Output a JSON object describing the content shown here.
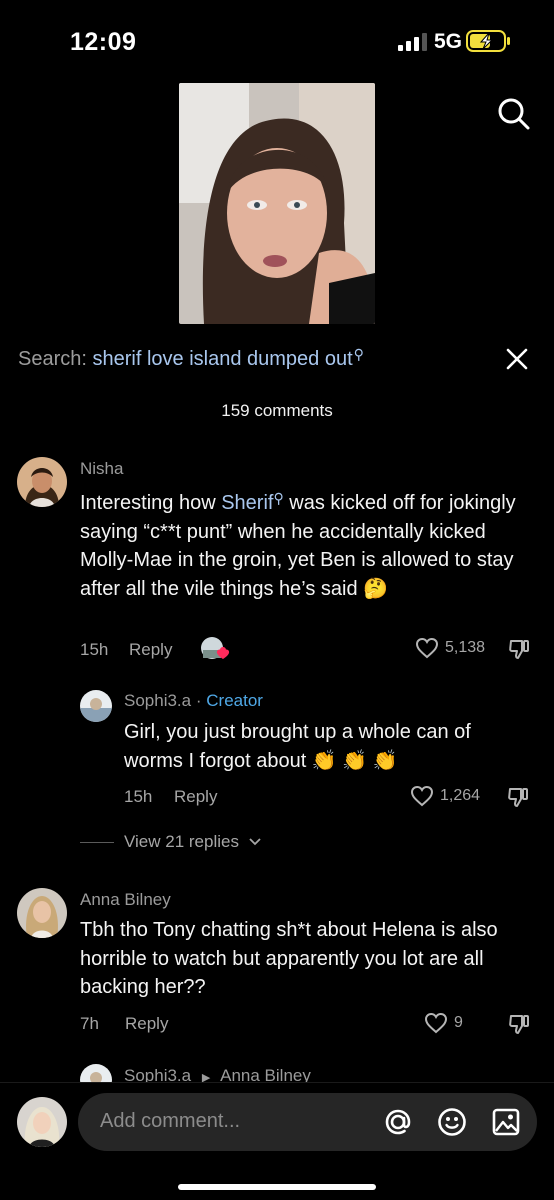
{
  "status_bar": {
    "time": "12:09",
    "network": "5G"
  },
  "search": {
    "prefix": "Search:",
    "query": "sherif love island dumped out",
    "search_icon": "search-icon",
    "close_icon": "close-icon"
  },
  "comments_count": "159 comments",
  "comments": [
    {
      "username": "Nisha",
      "text_before": "Interesting how ",
      "mention": "Sherif",
      "text_after": " was kicked off for jokingly saying “c**t punt” when he accidentally kicked Molly-Mae in the groin, yet Ben is allowed to stay after all the vile things he’s said 🤔",
      "time": "15h",
      "reply": "Reply",
      "likes": "5,138"
    },
    {
      "username": "Sophi3.a",
      "creator_label": "Creator",
      "text": "Girl, you just brought up a whole can of worms I forgot about 👏 👏 👏",
      "time": "15h",
      "reply": "Reply",
      "likes": "1,264"
    },
    {
      "username": "Anna Bilney",
      "text": "Tbh tho Tony chatting sh*t about Helena is also horrible to watch but apparently you lot are all backing her??",
      "time": "7h",
      "reply": "Reply",
      "likes": "9"
    }
  ],
  "view_replies": "View 21 replies",
  "next_reply": {
    "username": "Sophi3.a",
    "reply_to": "Anna Bilney"
  },
  "composer": {
    "placeholder": "Add comment..."
  },
  "colors": {
    "background": "#000000",
    "link": "#a9c7ee",
    "creator": "#4fa8e6",
    "like_heart": "#ff2b5c"
  }
}
